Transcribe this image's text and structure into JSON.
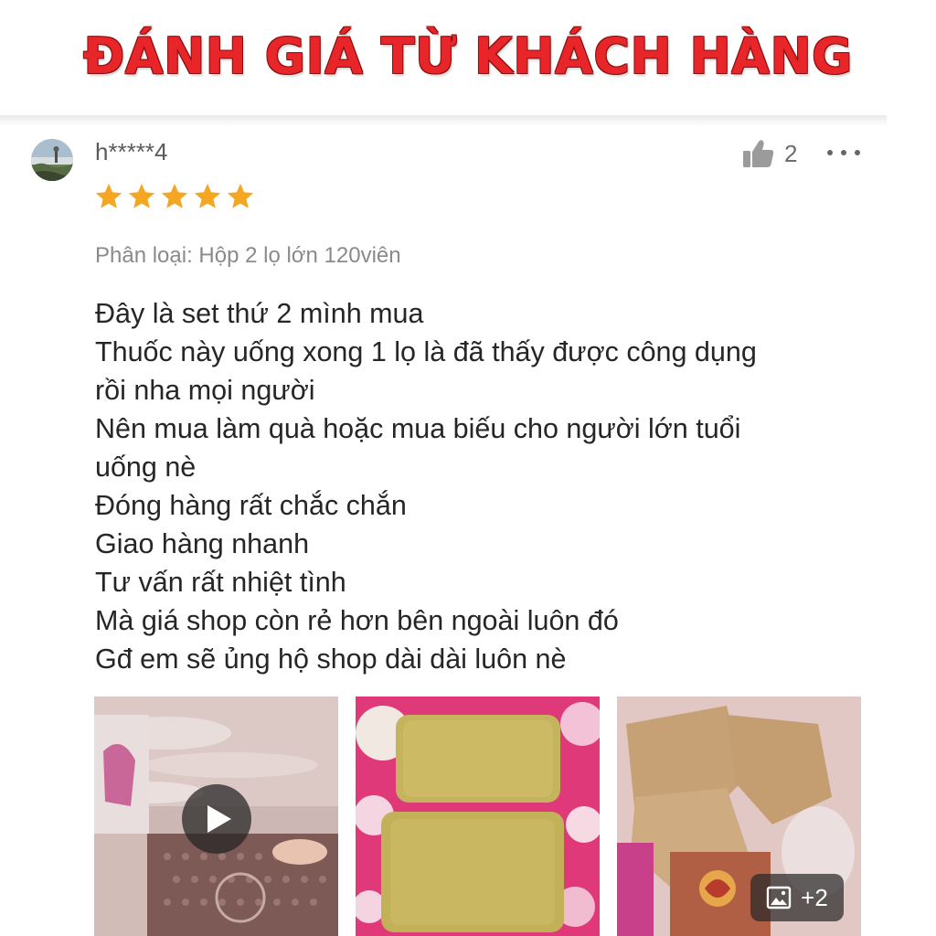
{
  "banner": {
    "title": "ĐÁNH GIÁ TỪ KHÁCH HÀNG",
    "color": "#e8262a"
  },
  "review": {
    "username": "h*****4",
    "rating": 5,
    "rating_max": 5,
    "star_color": "#f5a623",
    "like_count": "2",
    "variant": "Phân loại: Hộp 2 lọ lớn 120viên",
    "lines": [
      "Đây là set thứ 2 mình mua",
      "Thuốc này uống xong 1 lọ là đã thấy được công dụng",
      "rồi nha mọi người",
      "Nên mua làm quà hoặc mua biếu cho người lớn tuổi",
      "uống nè",
      "Đóng hàng rất chắc chắn",
      "Giao hàng nhanh",
      "Tư vấn rất nhiệt tình",
      "Mà giá shop còn rẻ hơn bên ngoài luôn đó",
      "Gđ em sẽ ủng hộ shop dài dài luôn nè"
    ]
  },
  "media": {
    "items": [
      {
        "kind": "video",
        "icon": "play-icon"
      },
      {
        "kind": "photo",
        "icon": "image"
      },
      {
        "kind": "photo",
        "icon": "image"
      }
    ],
    "more_count": "+2"
  },
  "icons": {
    "avatar": "avatar-photo",
    "like": "thumbs-up-icon",
    "more": "more-dots-icon",
    "star": "star-icon",
    "play": "play-icon",
    "gallery": "gallery-icon"
  }
}
